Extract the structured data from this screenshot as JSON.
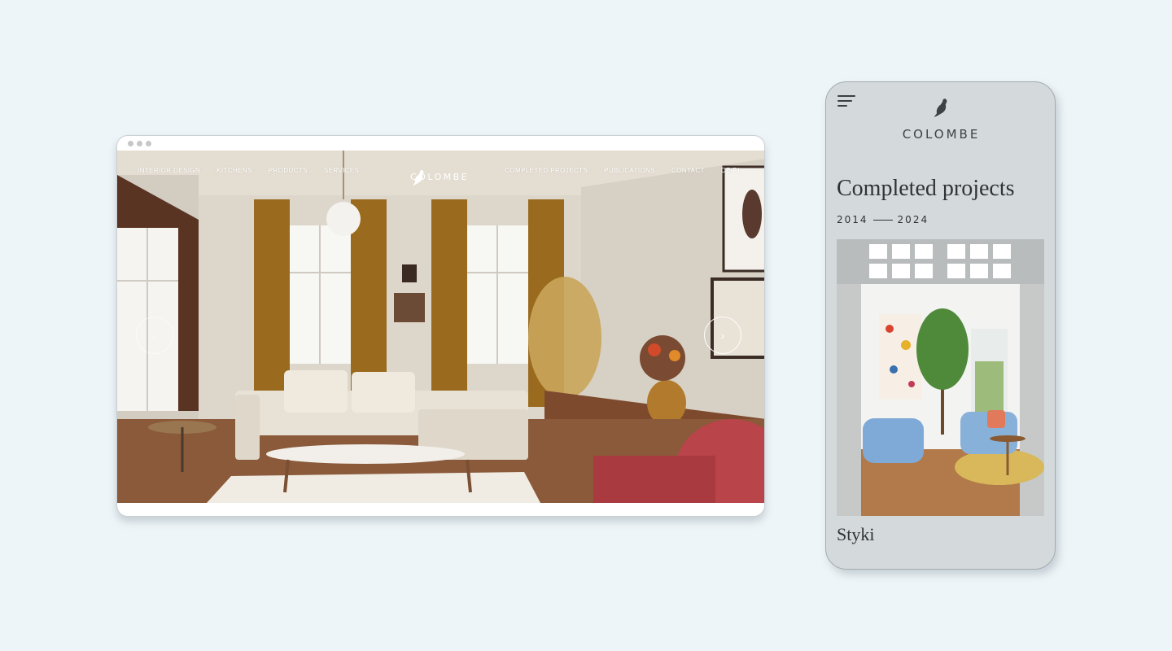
{
  "desktop": {
    "nav_left": [
      "INTERIOR DESIGN",
      "KITCHENS",
      "PRODUCTS",
      "SERVICES"
    ],
    "nav_right": [
      "COMPLETED PROJECTS",
      "PUBLICATIONS",
      "CONTACT",
      "DE/PL"
    ],
    "logo_text": "COLOMBE",
    "prev_arrow": "‹",
    "next_arrow": "›"
  },
  "mobile": {
    "logo_text": "COLOMBE",
    "heading": "Completed projects",
    "year_start": "2014",
    "year_end": "2024",
    "project_title": "Styki"
  },
  "colors": {
    "background": "#eef5f8",
    "phone_bg": "#d4d9db",
    "curtain": "#9a6a1e",
    "text_dark": "#2f3336"
  }
}
